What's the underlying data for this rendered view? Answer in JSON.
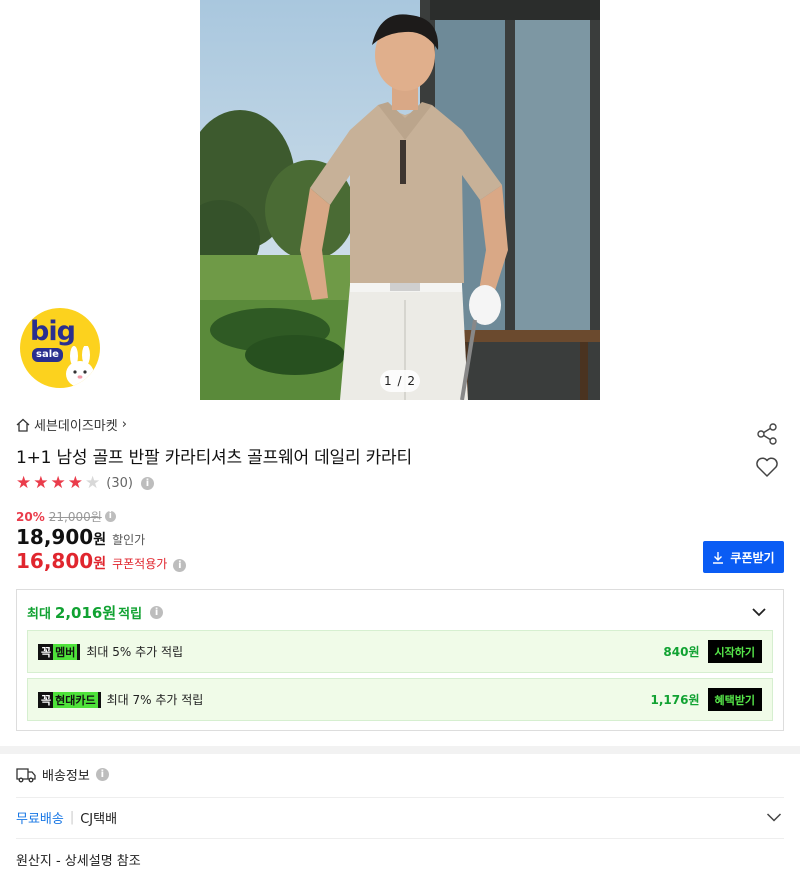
{
  "hero": {
    "pager": "1 / 2"
  },
  "badge": {
    "big": "big",
    "sale": "sale"
  },
  "store": {
    "name": "세븐데이즈마켓",
    "chevron": "›"
  },
  "product": {
    "title": "1+1 남성 골프 반팔 카라티셔츠 골프웨어 데일리 카라티",
    "rating": {
      "stars_filled": 4,
      "stars_total": 5,
      "review_count": "(30)"
    }
  },
  "price": {
    "discount_rate": "20%",
    "original": "21,000원",
    "sale_value": "18,900",
    "sale_unit": "원",
    "sale_label": "할인가",
    "coupon_value": "16,800",
    "coupon_unit": "원",
    "coupon_label": "쿠폰적용가"
  },
  "coupon_button": {
    "label": "쿠폰받기"
  },
  "points": {
    "prefix": "최대",
    "amount": "2,016원",
    "suffix": "적립",
    "benefits": [
      {
        "tag": "꼭",
        "tag_highlight": "멤버",
        "text": "최대 5% 추가 적립",
        "amount": "840원",
        "button": "시작하기"
      },
      {
        "tag": "꼭",
        "tag_highlight": "현대카드",
        "text": "최대 7% 추가 적립",
        "amount": "1,176원",
        "button": "혜택받기"
      }
    ]
  },
  "shipping": {
    "title": "배송정보",
    "free": "무료배송",
    "separator": "|",
    "carrier": "CJ택배",
    "origin": "원산지 - 상세설명 참조"
  },
  "colors": {
    "accent_blue": "#0a5cf4",
    "price_red": "#e0262e",
    "star_red": "#ea3c4b",
    "points_green": "#11a232",
    "badge_yellow": "#fcd21e"
  }
}
